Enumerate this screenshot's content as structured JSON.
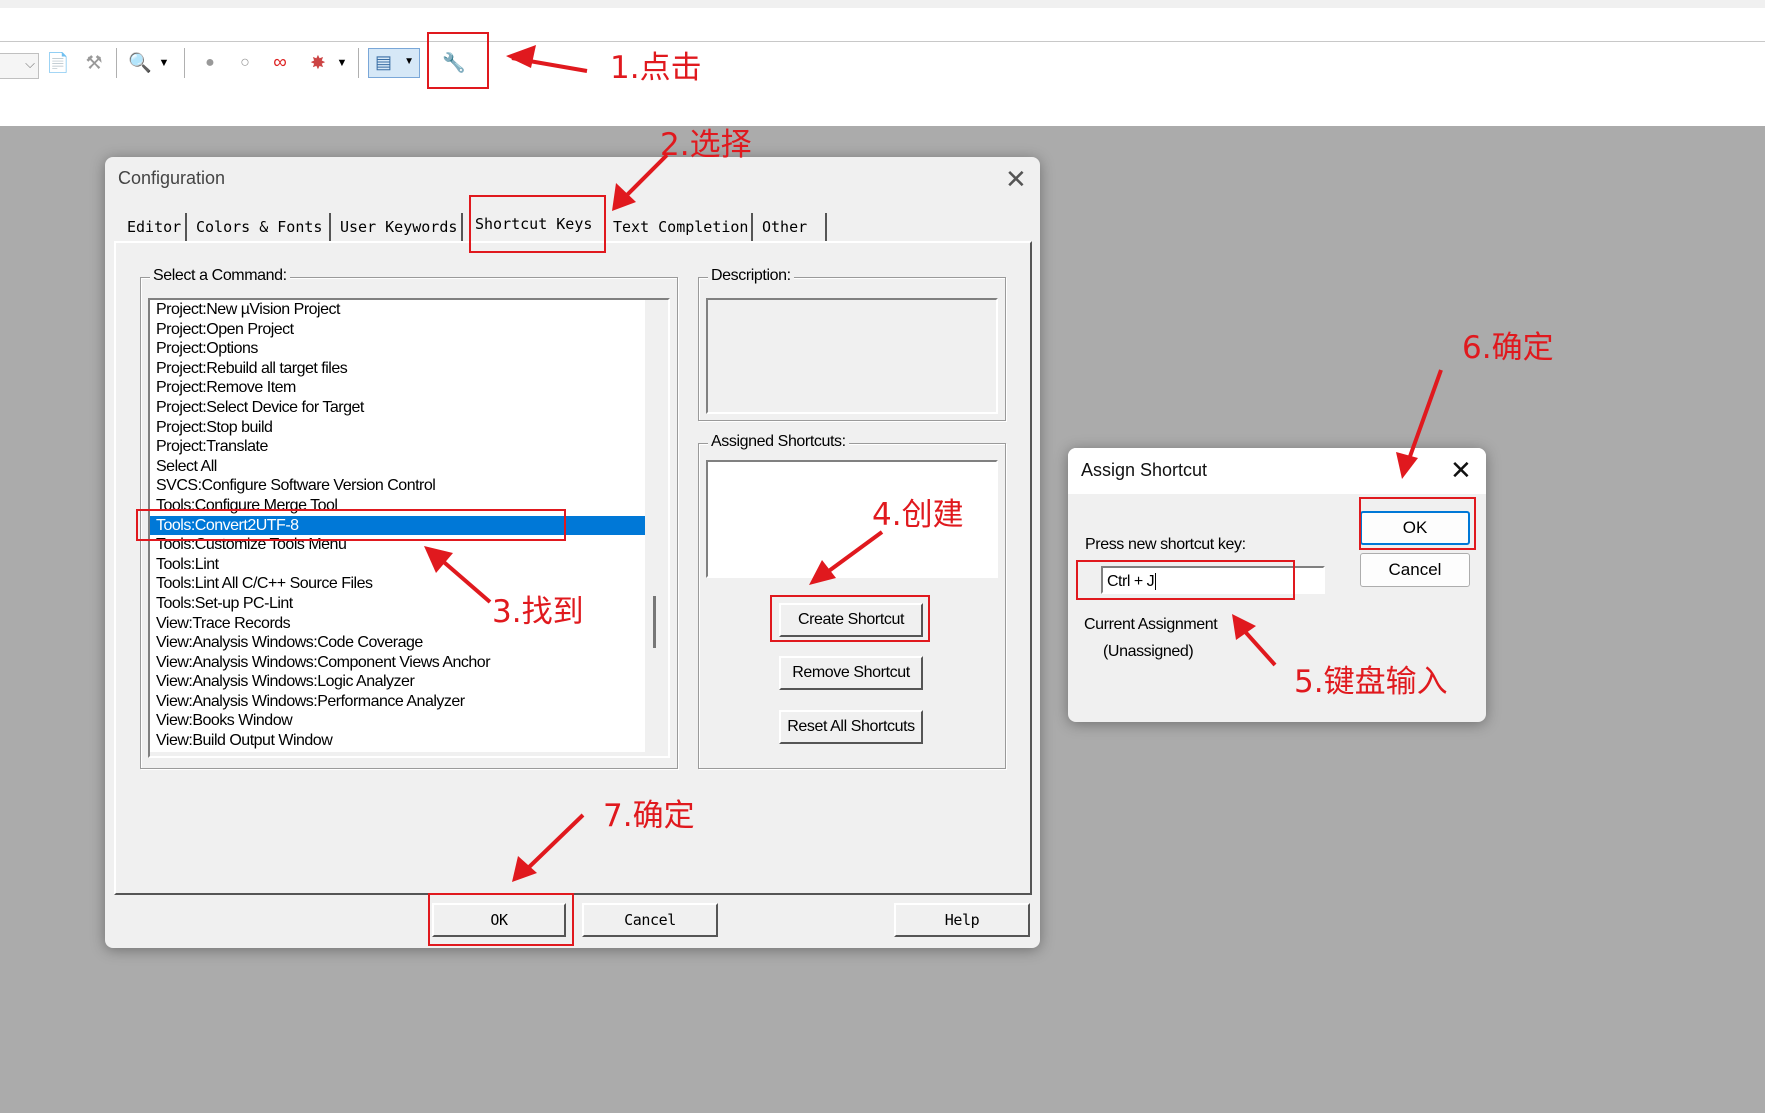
{
  "toolbar": {
    "icons": [
      "dropdown-icon",
      "document-icon",
      "build-icon",
      "search-icon",
      "breakpoint-icon",
      "circle-icon",
      "link-icon",
      "bug-icon",
      "window-icon",
      "wrench-icon"
    ]
  },
  "config_dialog": {
    "title": "Configuration",
    "tabs": [
      "Editor",
      "Colors & Fonts",
      "User Keywords",
      "Shortcut Keys",
      "Text Completion",
      "Other"
    ],
    "select_command_label": "Select a Command:",
    "description_label": "Description:",
    "assigned_shortcuts_label": "Assigned Shortcuts:",
    "commands": [
      "Project:New µVision Project",
      "Project:Open Project",
      "Project:Options",
      "Project:Rebuild all target files",
      "Project:Remove Item",
      "Project:Select Device for Target",
      "Project:Stop build",
      "Project:Translate",
      "Select All",
      "SVCS:Configure Software Version Control",
      "Tools:Configure Merge Tool",
      "Tools:Convert2UTF-8",
      "Tools:Customize Tools Menu",
      "Tools:Lint",
      "Tools:Lint All C/C++ Source Files",
      "Tools:Set-up PC-Lint",
      "View:Trace Records",
      "View:Analysis Windows:Code Coverage",
      "View:Analysis Windows:Component Views Anchor",
      "View:Analysis Windows:Logic Analyzer",
      "View:Analysis Windows:Performance Analyzer",
      "View:Books Window",
      "View:Build Output Window"
    ],
    "selected_command": "Tools:Convert2UTF-8",
    "buttons": {
      "create_shortcut": "Create Shortcut",
      "remove_shortcut": "Remove Shortcut",
      "reset_all": "Reset All Shortcuts",
      "ok": "OK",
      "cancel": "Cancel",
      "help": "Help"
    }
  },
  "assign_dialog": {
    "title": "Assign Shortcut",
    "press_label": "Press new shortcut key:",
    "shortcut_value": "Ctrl + J",
    "current_assignment_label": "Current Assignment",
    "current_assignment_value": "(Unassigned)",
    "ok": "OK",
    "cancel": "Cancel"
  },
  "annotations": {
    "step1": "1.点击",
    "step2": "2.选择",
    "step3": "3.找到",
    "step4": "4.创建",
    "step5": "5.键盘输入",
    "step6": "6.确定",
    "step7": "7.确定"
  },
  "colors": {
    "annotation": "#e0191e",
    "selection": "#0078d7",
    "background": "#ababab"
  }
}
